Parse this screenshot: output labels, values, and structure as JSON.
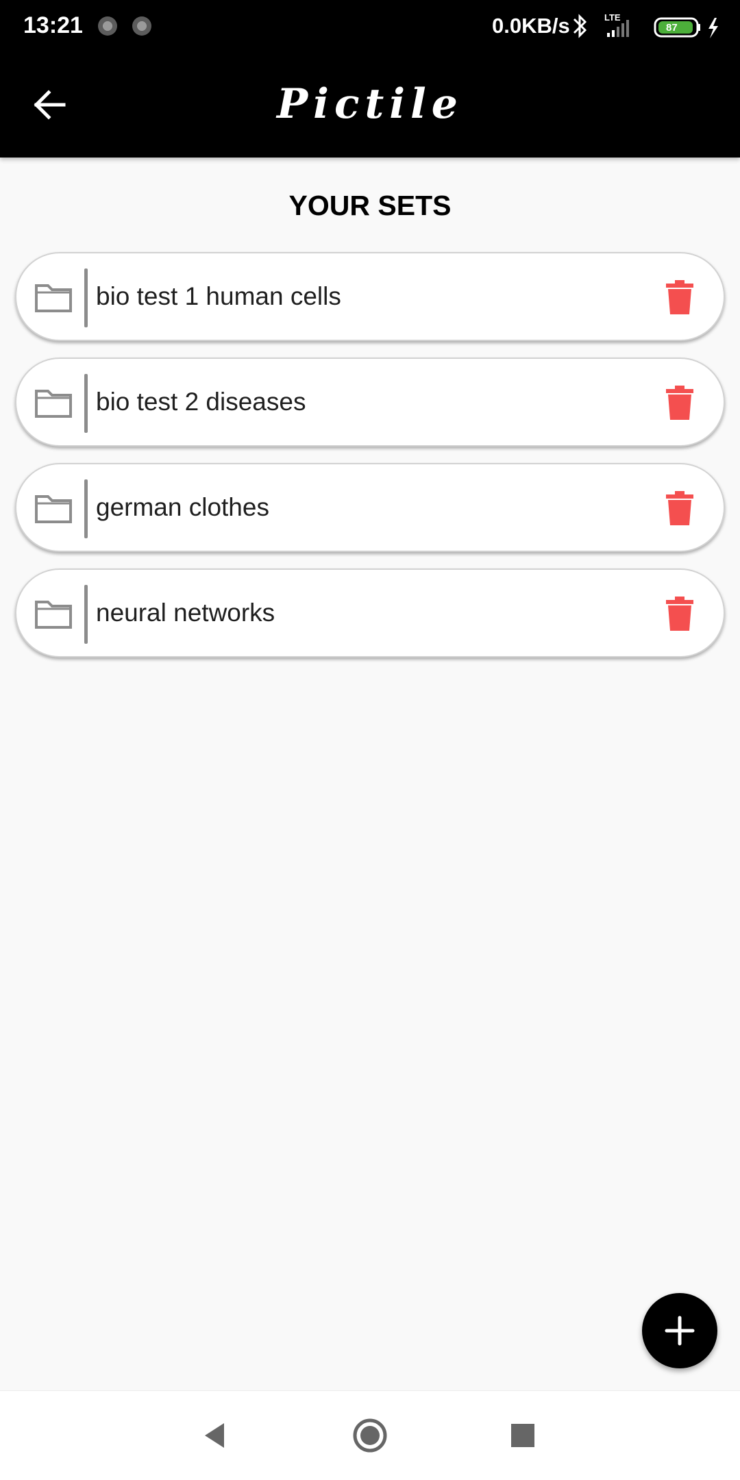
{
  "status_bar": {
    "time": "13:21",
    "network_speed": "0.0KB/s",
    "network_type": "LTE",
    "battery_level": "87"
  },
  "app_bar": {
    "title": "Pictile"
  },
  "main": {
    "heading": "YOUR SETS",
    "sets": [
      {
        "name": "bio test 1 human cells"
      },
      {
        "name": "bio test 2 diseases"
      },
      {
        "name": "german clothes"
      },
      {
        "name": "neural networks"
      }
    ]
  },
  "colors": {
    "accent": "#000000",
    "delete": "#f44f4f",
    "folder_icon": "#8c8c8c"
  },
  "icons": {
    "back": "arrow-left-icon",
    "folder": "folder-icon",
    "delete": "trash-icon",
    "add": "plus-icon"
  }
}
